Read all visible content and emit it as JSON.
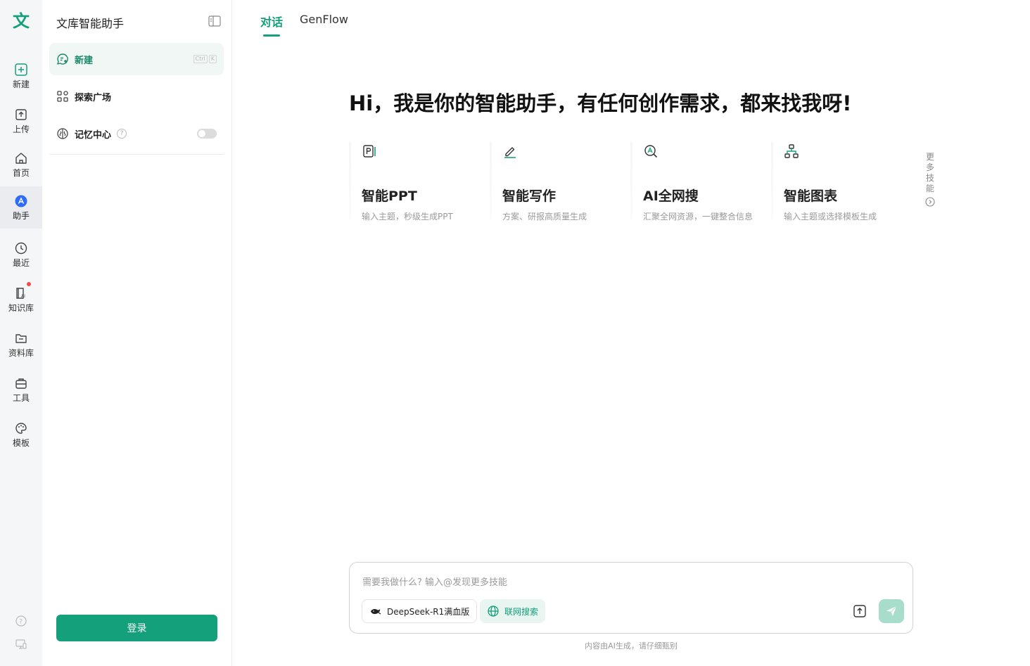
{
  "rail": {
    "logo": "文",
    "items": [
      {
        "label": "新建",
        "icon": "plus-square-icon"
      },
      {
        "label": "上传",
        "icon": "upload-icon"
      },
      {
        "label": "首页",
        "icon": "home-icon"
      },
      {
        "label": "助手",
        "icon": "assistant-icon"
      },
      {
        "label": "最近",
        "icon": "clock-icon"
      },
      {
        "label": "知识库",
        "icon": "knowledge-icon"
      },
      {
        "label": "资料库",
        "icon": "folder-icon"
      },
      {
        "label": "工具",
        "icon": "toolbox-icon"
      },
      {
        "label": "模板",
        "icon": "palette-icon"
      }
    ],
    "active": "助手"
  },
  "panel": {
    "title": "文库智能助手",
    "items": [
      {
        "label": "新建",
        "shortcut": [
          "Ctrl",
          "K"
        ]
      },
      {
        "label": "探索广场"
      },
      {
        "label": "记忆中心",
        "help": "?"
      }
    ],
    "login_label": "登录"
  },
  "tabs": [
    "对话",
    "GenFlow"
  ],
  "headline": "Hi，我是你的智能助手，有任何创作需求，都来找我呀!",
  "cards": [
    {
      "title": "智能PPT",
      "subtitle": "输入主题，秒级生成PPT",
      "icon": "ppt-icon"
    },
    {
      "title": "智能写作",
      "subtitle": "方案、研报高质量生成",
      "icon": "pen-icon"
    },
    {
      "title": "AI全网搜",
      "subtitle": "汇聚全网资源，一键整合信息",
      "icon": "search-web-icon"
    },
    {
      "title": "智能图表",
      "subtitle": "输入主题或选择模板生成",
      "icon": "flowchart-icon"
    }
  ],
  "more_skills": "更多技能",
  "input": {
    "placeholder": "需要我做什么? 输入@发现更多技能",
    "model_chip": "DeepSeek-R1满血版",
    "web_chip": "联网搜索"
  },
  "disclaimer": "内容由AI生成，请仔细甄别",
  "colors": {
    "accent": "#13a07a",
    "rail_bg": "#f5f6f7",
    "send_disabled": "#a8ddcb"
  }
}
